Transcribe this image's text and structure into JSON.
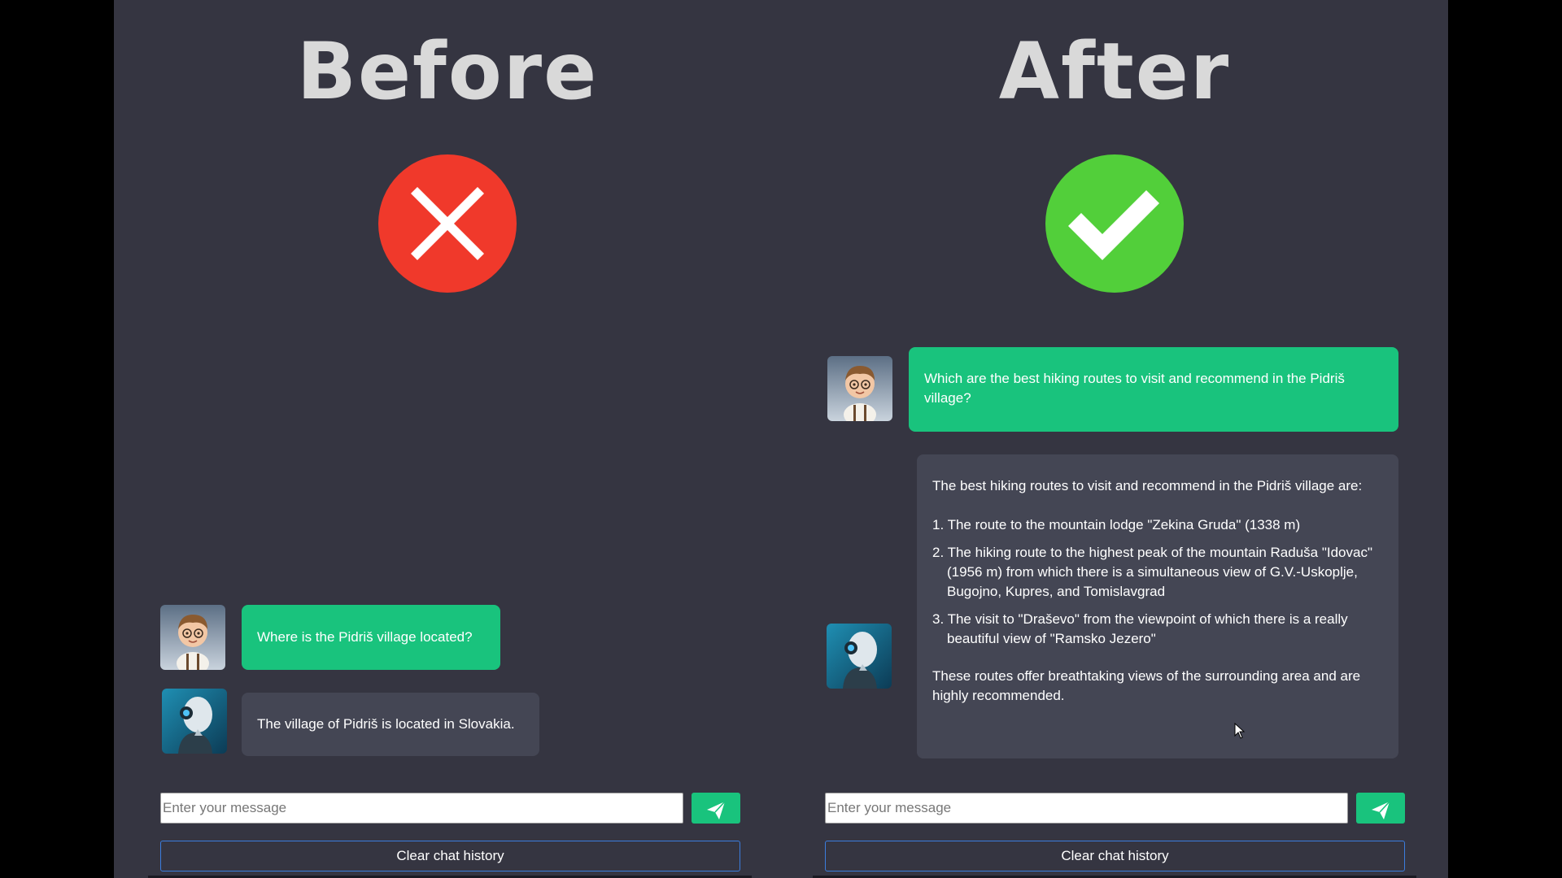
{
  "before": {
    "heading": "Before",
    "badge_icon": "red-x-icon",
    "badge_color": "#f0392b",
    "user_message": "Where is the Pidriš village located?",
    "bot_message": "The village of Pidriš is located in Slovakia.",
    "input_placeholder": "Enter your message",
    "send_icon": "paper-plane-icon",
    "clear_label": "Clear chat history"
  },
  "after": {
    "heading": "After",
    "badge_icon": "green-check-icon",
    "badge_color": "#52cf3a",
    "user_message": "Which are the best hiking routes to visit and recommend in the Pidriš village?",
    "bot_intro": "The best hiking routes to visit and recommend in the Pidriš village are:",
    "bot_routes": [
      "1. The route to the mountain lodge \"Zekina Gruda\" (1338 m)",
      "2. The hiking route to the highest peak of the mountain Raduša \"Idovac\" (1956 m) from which there is a simultaneous view of G.V.-Uskoplje, Bugojno, Kupres, and Tomislavgrad",
      "3. The visit to \"Draševo\" from the viewpoint of which there is a really beautiful view of \"Ramsko Jezero\""
    ],
    "bot_outro": "These routes offer breathtaking views of the surrounding area and are highly recommended.",
    "input_placeholder": "Enter your message",
    "send_icon": "paper-plane-icon",
    "clear_label": "Clear chat history"
  },
  "colors": {
    "background": "#353541",
    "user_bubble": "#19c37d",
    "bot_bubble": "#444654",
    "accent_border": "#3b7ddd"
  }
}
